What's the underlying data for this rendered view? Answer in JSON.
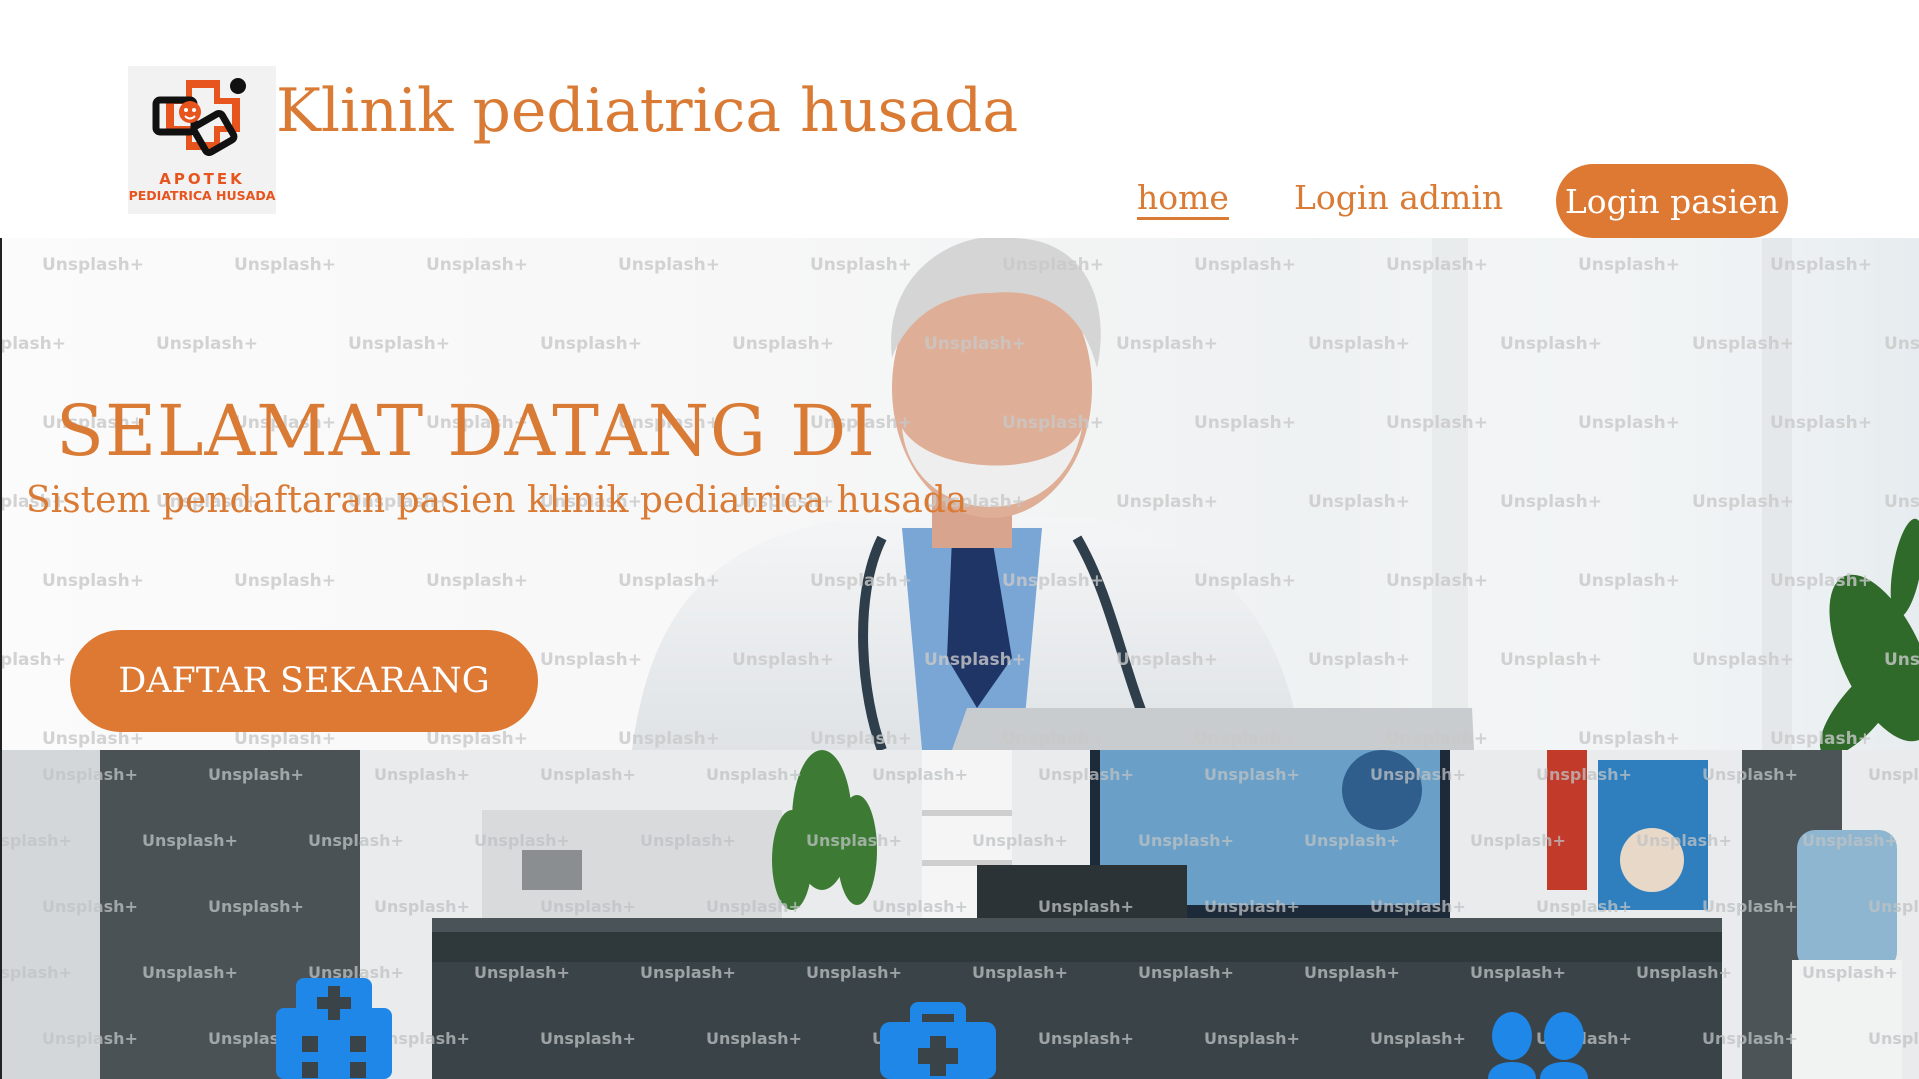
{
  "brand": {
    "title": "Klinik pediatrica husada",
    "logo_line1": "APOTEK",
    "logo_line2": "PEDIATRICA HUSADA"
  },
  "nav": {
    "home": "home",
    "login_admin": "Login admin",
    "login_pasien": "Login pasien"
  },
  "hero": {
    "heading": "SELAMAT DATANG DI",
    "subheading": "Sistem pendaftaran pasien klinik pediatrica husada",
    "cta": "DAFTAR SEKARANG",
    "watermark": "Unsplash+"
  },
  "features": {
    "icons": [
      "hospital-building-icon",
      "medical-kit-icon",
      "users-group-icon"
    ]
  },
  "colors": {
    "accent": "#de7934",
    "title_text": "#d97b34",
    "feature_icon": "#1f87e8"
  }
}
